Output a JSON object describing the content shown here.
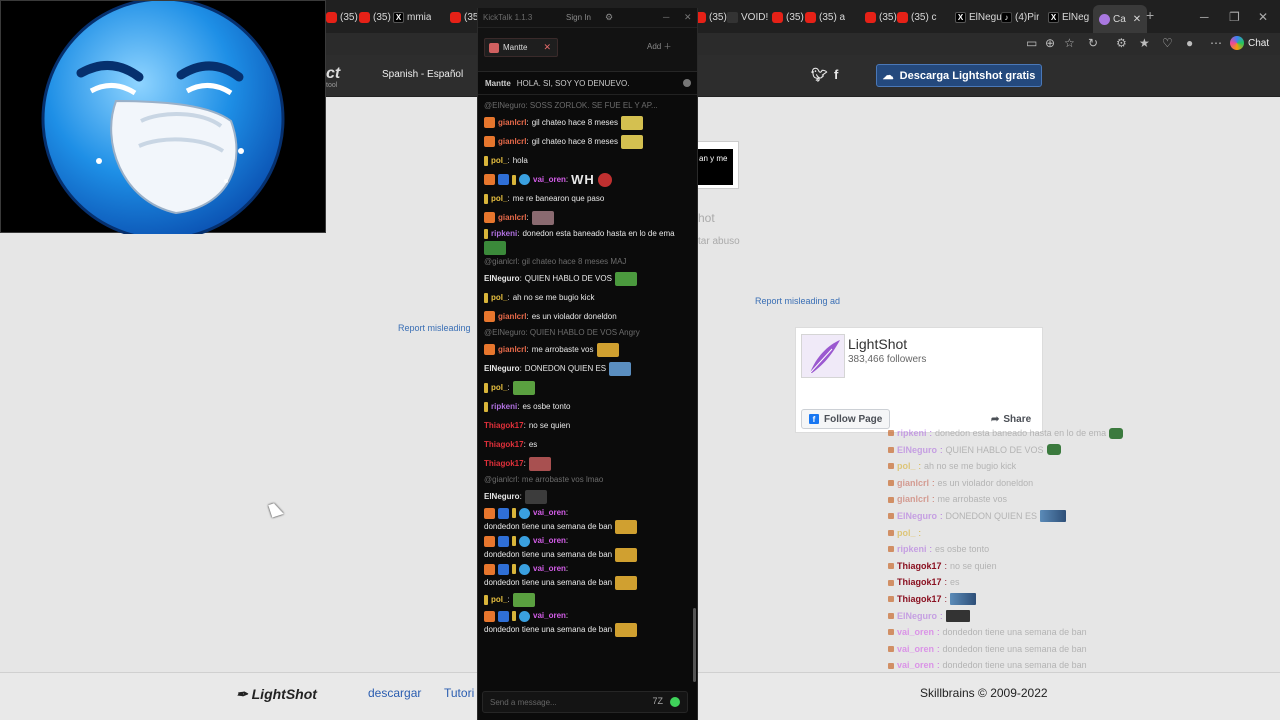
{
  "browser": {
    "tabs": [
      {
        "label": "(35) El",
        "icon": "youtube-icon"
      },
      {
        "label": "(35) H",
        "icon": "youtube-icon"
      },
      {
        "label": "mmia",
        "icon": "x-icon"
      },
      {
        "label": "(35) E",
        "icon": "youtube-icon"
      },
      {
        "label": "(35) p",
        "icon": "youtube-icon"
      },
      {
        "label": "VOID!",
        "icon": "sv-icon"
      },
      {
        "label": "(35) A",
        "icon": "youtube-icon"
      },
      {
        "label": "(35) a",
        "icon": "youtube-icon"
      },
      {
        "label": "(35) F",
        "icon": "youtube-icon"
      },
      {
        "label": "(35) c",
        "icon": "youtube-icon"
      },
      {
        "label": "ElNegu",
        "icon": "x-icon"
      },
      {
        "label": "(4)Pir",
        "icon": "tiktok-icon"
      },
      {
        "label": "ElNeg",
        "icon": "x-icon"
      },
      {
        "label": "Ca",
        "icon": "lightshot-icon"
      }
    ],
    "new_tab": "+",
    "chat_label": "Chat"
  },
  "site": {
    "logo_partial": "ct",
    "logo_sub": "tool",
    "language": "Spanish - Español",
    "download_button": "Descarga Lightshot gratis",
    "report_ad_1": "Report misleading ad",
    "report_ad_2": "Report misleading",
    "ad_snippet": "an y me",
    "ghost_text_1": "hot",
    "ghost_text_2": "tar abuso",
    "footer_logo": "LightShot",
    "footer_links": [
      "descargar",
      "Tutori"
    ],
    "copyright": "Skillbrains © 2009-2022"
  },
  "facebook": {
    "page_name": "LightShot",
    "followers": "383,466 followers",
    "follow_label": "Follow Page",
    "share_label": "Share"
  },
  "kicktalk": {
    "title": "KickTalk 1.1.3",
    "sign_in": "Sign In",
    "tab_label": "Mantte",
    "add_label": "Add",
    "pinned_user": "Mantte",
    "pinned_text": "HOLA. SI, SOY YO DENUEVO.",
    "input_placeholder": "Send a message...",
    "messages": [
      {
        "kind": "reply",
        "text": "@ElNeguro: SOSS ZORLOK. SE FUE EL Y AP..."
      },
      {
        "user": "gianlcrl",
        "color": "#e86a4a",
        "badges": [
          "sub"
        ],
        "text": "gil chateo hace 8 meses",
        "emote": "#d4c050"
      },
      {
        "user": "gianlcrl",
        "color": "#e86a4a",
        "badges": [
          "sub"
        ],
        "text": "gil chateo hace 8 meses",
        "emote": "#d4c050"
      },
      {
        "user": "pol_",
        "color": "#e8c040",
        "badges": [
          "pin"
        ],
        "text": "hola"
      },
      {
        "user": "vai_oren",
        "color": "#d35de8",
        "badges": [
          "sub",
          "blu",
          "pin",
          "gem"
        ],
        "text": "WH",
        "big": true,
        "emote": "#c03030"
      },
      {
        "user": "pol_",
        "color": "#e8c040",
        "badges": [
          "pin"
        ],
        "text": "me re banearon que paso"
      },
      {
        "user": "gianlcrl",
        "color": "#e86a4a",
        "badges": [
          "sub"
        ],
        "text": "",
        "emote": "#8a6a70"
      },
      {
        "user": "ripkeni",
        "color": "#b070e0",
        "badges": [
          "pin"
        ],
        "text": "donedon esta baneado hasta en lo de ema",
        "emote": "#3b8a3a"
      },
      {
        "kind": "reply",
        "text": "@gianlcrl: gil chateo hace 8 meses MAJ"
      },
      {
        "user": "ElNeguro",
        "color": "#e6e6e6",
        "badges": [],
        "text": "QUIEN HABLO DE VOS",
        "emote": "#4b9a3e"
      },
      {
        "user": "pol_",
        "color": "#e8c040",
        "badges": [
          "pin"
        ],
        "text": "ah no se me bugio kick"
      },
      {
        "user": "gianlcrl",
        "color": "#e86a4a",
        "badges": [
          "sub"
        ],
        "text": "es un violador doneldon"
      },
      {
        "kind": "reply",
        "text": "@ElNeguro: QUIEN HABLO DE VOS Angry"
      },
      {
        "user": "gianlcrl",
        "color": "#e86a4a",
        "badges": [
          "sub"
        ],
        "text": "me arrobaste vos",
        "emote": "#d0a030"
      },
      {
        "user": "ElNeguro",
        "color": "#e6e6e6",
        "badges": [],
        "text": "DONEDON QUIEN ES",
        "emote": "#5a8ec0"
      },
      {
        "user": "pol_",
        "color": "#e8c040",
        "badges": [
          "pin"
        ],
        "text": "",
        "emote": "#5aa040"
      },
      {
        "user": "ripkeni",
        "color": "#b070e0",
        "badges": [
          "pin"
        ],
        "text": "es osbe tonto"
      },
      {
        "user": "Thiagok17",
        "color": "#e0303a",
        "badges": [],
        "text": "no se quien"
      },
      {
        "user": "Thiagok17",
        "color": "#e0303a",
        "badges": [],
        "text": "es"
      },
      {
        "user": "Thiagok17",
        "color": "#e0303a",
        "badges": [],
        "text": "",
        "emote": "#a85050"
      },
      {
        "kind": "reply",
        "text": "@gianlcrl: me arrobaste vos lmao"
      },
      {
        "user": "ElNeguro",
        "color": "#e6e6e6",
        "badges": [],
        "text": "",
        "emote": "#3c3c3c"
      },
      {
        "user": "vai_oren",
        "color": "#d35de8",
        "badges": [
          "sub",
          "blu",
          "pin",
          "gem"
        ],
        "text": "dondedon tiene una semana de ban",
        "emote": "#d0a030"
      },
      {
        "user": "vai_oren",
        "color": "#d35de8",
        "badges": [
          "sub",
          "blu",
          "pin",
          "gem"
        ],
        "text": "dondedon tiene una semana de ban",
        "emote": "#d0a030"
      },
      {
        "user": "vai_oren",
        "color": "#d35de8",
        "badges": [
          "sub",
          "blu",
          "pin",
          "gem"
        ],
        "text": "dondedon tiene una semana de ban",
        "emote": "#d0a030"
      },
      {
        "user": "pol_",
        "color": "#e8c040",
        "badges": [
          "pin"
        ],
        "text": "",
        "emote": "#5aa040"
      },
      {
        "user": "vai_oren",
        "color": "#d35de8",
        "badges": [
          "sub",
          "blu",
          "pin",
          "gem"
        ],
        "text": "dondedon tiene una semana de ban",
        "emote": "#d0a030"
      }
    ]
  },
  "overlay_chat": [
    {
      "user": "ripkeni",
      "color": "#b070e0",
      "text": "donedon esta baneado hasta en lo de ema",
      "emote": "green"
    },
    {
      "user": "ElNeguro",
      "color": "#b070e0",
      "text": "QUIEN HABLO DE VOS",
      "emote": "green"
    },
    {
      "user": "pol_",
      "color": "#d8b030",
      "text": "ah no se me bugio kick"
    },
    {
      "user": "gianlcrl",
      "color": "#c86a5a",
      "text": "es un violador doneldon"
    },
    {
      "user": "gianlcrl",
      "color": "#c86a5a",
      "text": "me arrobaste vos"
    },
    {
      "user": "ElNeguro",
      "color": "#b070e0",
      "text": "DONEDON QUIEN ES",
      "emote": "img"
    },
    {
      "user": "pol_",
      "color": "#d8b030",
      "text": ""
    },
    {
      "user": "ripkeni",
      "color": "#b070e0",
      "text": "es osbe tonto"
    },
    {
      "user": "Thiagok17",
      "color": "#8a1020",
      "text": "no se quien"
    },
    {
      "user": "Thiagok17",
      "color": "#8a1020",
      "text": "es"
    },
    {
      "user": "Thiagok17",
      "color": "#8a1020",
      "text": "",
      "emote": "img"
    },
    {
      "user": "ElNeguro",
      "color": "#b070e0",
      "text": "",
      "emote": "dark"
    },
    {
      "user": "vai_oren",
      "color": "#d35de8",
      "text": "dondedon tiene una semana de ban"
    },
    {
      "user": "vai_oren",
      "color": "#d35de8",
      "text": "dondedon tiene una semana de ban"
    },
    {
      "user": "vai_oren",
      "color": "#d35de8",
      "text": "dondedon tiene una semana de ban"
    },
    {
      "user": "pol_",
      "color": "#d8b030",
      "text": ""
    },
    {
      "user": "vai_oren",
      "color": "#d35de8",
      "text": "dondedon tiene una semana de ban"
    }
  ],
  "colors": {
    "download_button": "#24497d",
    "page_background": "#e6e6e6",
    "chat_background": "#0b0b0b",
    "accent_green": "#3fd35a"
  }
}
